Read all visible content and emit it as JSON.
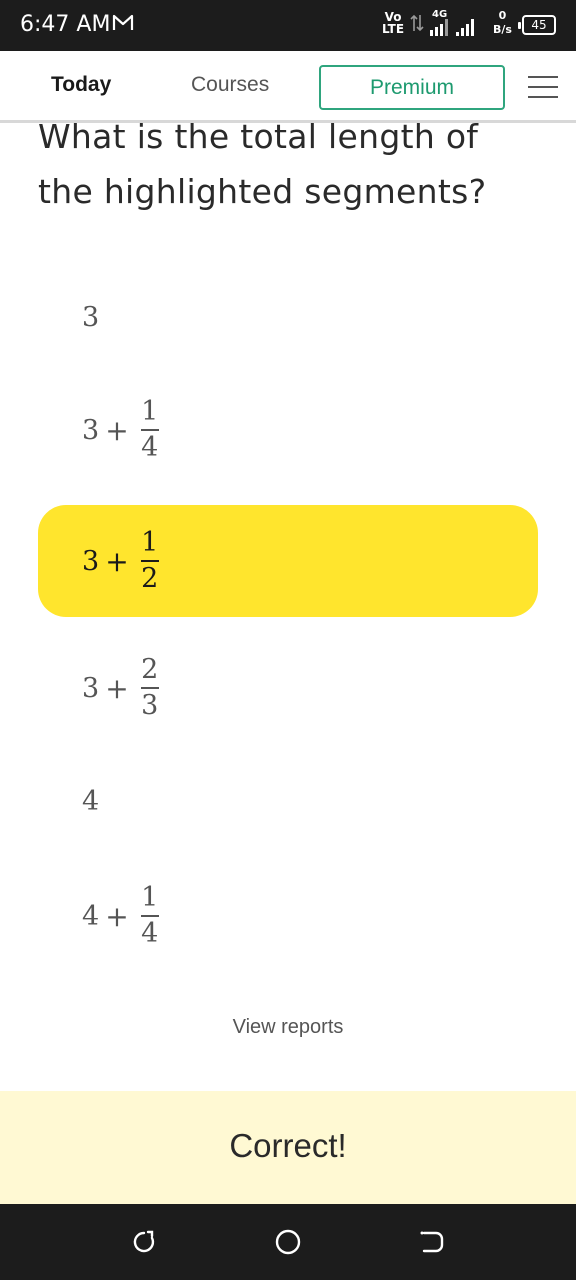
{
  "status_bar": {
    "time": "6:47 AM",
    "mail_icon": "gmail-icon",
    "volte_top": "Vo",
    "volte_bottom": "LTE",
    "network": "4G",
    "speed_value": "0",
    "speed_unit": "B/s",
    "battery": "45"
  },
  "header": {
    "tabs": [
      {
        "label": "Today",
        "active": true
      },
      {
        "label": "Courses",
        "active": false
      }
    ],
    "premium_label": "Premium",
    "menu_icon": "hamburger-menu-icon",
    "accent_color": "#2fa57e"
  },
  "question": {
    "text": "What is the total length of the highlighted segments?"
  },
  "options": [
    {
      "whole": "3",
      "plus": "",
      "num": "",
      "den": "",
      "selected": false
    },
    {
      "whole": "3",
      "plus": "+",
      "num": "1",
      "den": "4",
      "selected": false
    },
    {
      "whole": "3",
      "plus": "+",
      "num": "1",
      "den": "2",
      "selected": true
    },
    {
      "whole": "3",
      "plus": "+",
      "num": "2",
      "den": "3",
      "selected": false
    },
    {
      "whole": "4",
      "plus": "",
      "num": "",
      "den": "",
      "selected": false
    },
    {
      "whole": "4",
      "plus": "+",
      "num": "1",
      "den": "4",
      "selected": false
    }
  ],
  "selected_color": "#ffe52d",
  "view_reports_label": "View reports",
  "feedback": {
    "text": "Correct!",
    "background": "#fff9d3"
  },
  "nav_bar": {
    "buttons": [
      "recents-icon",
      "home-icon",
      "back-icon"
    ]
  }
}
